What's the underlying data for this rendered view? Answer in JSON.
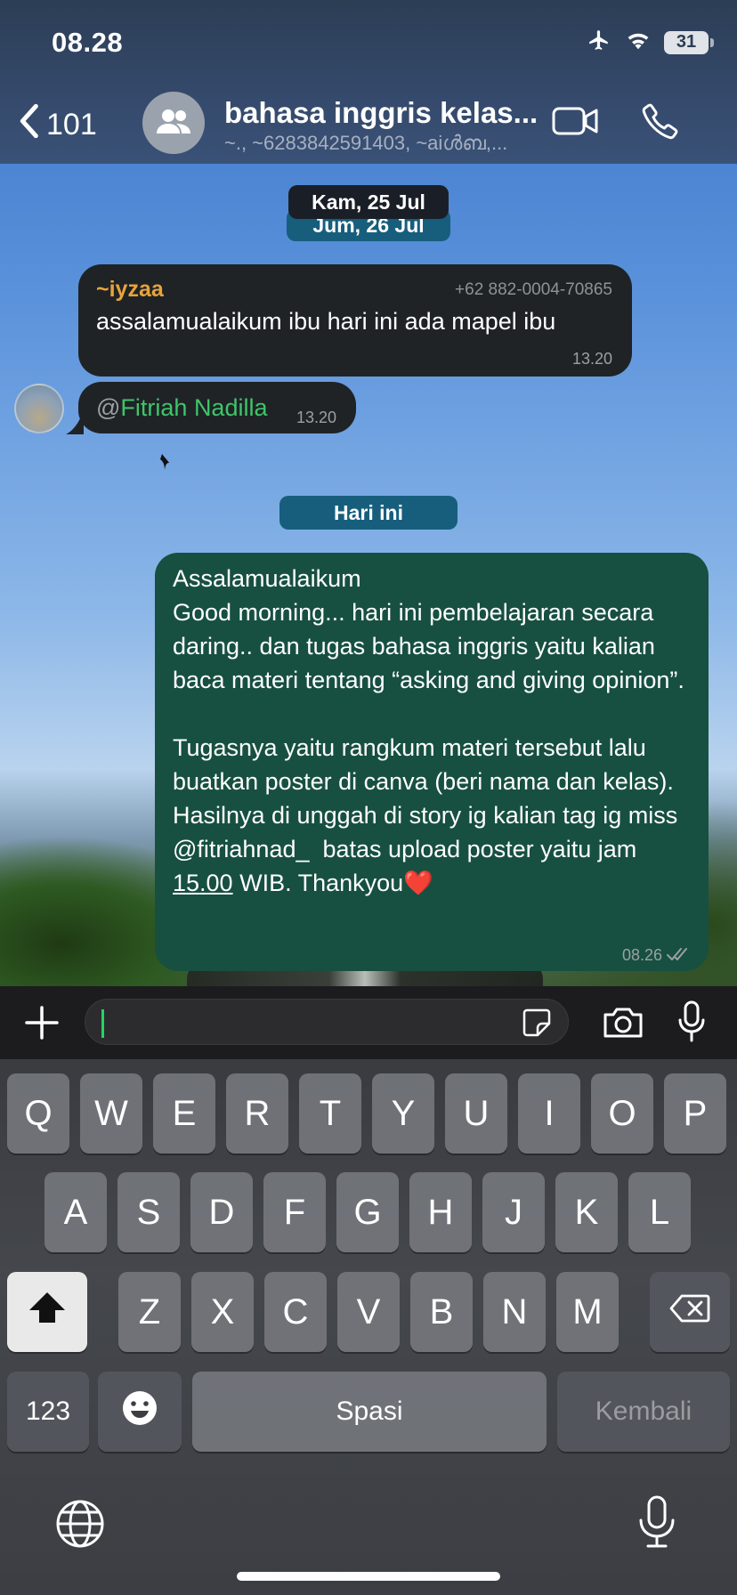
{
  "status_bar": {
    "time": "08.28",
    "battery": "31"
  },
  "header": {
    "back_count": "101",
    "title": "bahasa inggris kelas...",
    "subtitle": "~., ~6283842591403, ~aiൾബ,..."
  },
  "dates": {
    "sticky_top": "Kam, 25 Jul",
    "sticky_under": "Jum, 26 Jul",
    "today": "Hari ini"
  },
  "messages": {
    "m1": {
      "sender": "~iyzaa",
      "phone": "+62 882-0004-70865",
      "text": "assalamualaikum ibu hari ini ada mapel ibu",
      "time": "13.20"
    },
    "m2": {
      "at": "@",
      "mention": "Fitriah Nadilla",
      "time": "13.20"
    },
    "m3": {
      "line1": "Assalamualaikum",
      "para1": "Good morning... hari ini pembelajaran secara daring.. dan tugas bahasa inggris yaitu kalian baca materi tentang “asking and giving opinion”.",
      "para2_start": "Tugasnya yaitu rangkum materi tersebut lalu buatkan poster di canva (beri nama dan kelas). Hasilnya di unggah di story ig kalian tag ig miss @fitriahnad_  batas upload poster yaitu jam ",
      "para2_time": "15.00",
      "para2_end": " WIB. Thankyou",
      "emoji": "❤️",
      "time": "08.26"
    }
  },
  "keyboard": {
    "row1": [
      "Q",
      "W",
      "E",
      "R",
      "T",
      "Y",
      "U",
      "I",
      "O",
      "P"
    ],
    "row2": [
      "A",
      "S",
      "D",
      "F",
      "G",
      "H",
      "J",
      "K",
      "L"
    ],
    "row3": [
      "Z",
      "X",
      "C",
      "V",
      "B",
      "N",
      "M"
    ],
    "numbers": "123",
    "space": "Spasi",
    "return": "Kembali"
  },
  "colors": {
    "accent_green": "#25d366",
    "sender_orange": "#e8a33a",
    "mention_green": "#3fc56b",
    "outgoing_bubble": "#175040"
  }
}
